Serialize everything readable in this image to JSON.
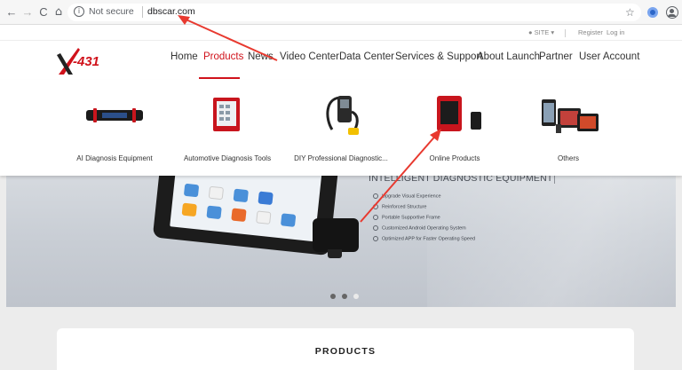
{
  "browser": {
    "icons": {
      "back": "back-arrow-icon",
      "forward": "forward-arrow-icon",
      "reload": "reload-icon",
      "home": "home-icon",
      "info": "info-icon",
      "star": "star-icon",
      "extension": "extension-icon",
      "account": "account-icon"
    },
    "security_label": "Not secure",
    "url": "dbscar.com"
  },
  "topbar": {
    "site_label": "SITE",
    "register_label": "Register",
    "login_label": "Log in"
  },
  "brand": {
    "logo_text": "-431",
    "accent_color": "#d0121b"
  },
  "main_nav": {
    "items": [
      {
        "label": "Home"
      },
      {
        "label": "Products",
        "active": true
      },
      {
        "label": "News"
      },
      {
        "label": "Video Center"
      },
      {
        "label": "Data Center"
      },
      {
        "label": "Services & Support"
      },
      {
        "label": "About Launch"
      },
      {
        "label": "Partner"
      },
      {
        "label": "User Account"
      }
    ]
  },
  "products_dropdown": {
    "categories": [
      {
        "label": "AI Diagnosis Equipment"
      },
      {
        "label": "Automotive Diagnosis Tools"
      },
      {
        "label": "DIY Professional Diagnostic..."
      },
      {
        "label": "Online Products"
      },
      {
        "label": "Others"
      }
    ]
  },
  "hero": {
    "title": "INTELLIGENT DIAGNOSTIC EQUIPMENT",
    "features": [
      {
        "text": "Upgrade Visual Experience"
      },
      {
        "text": "Reinforced Structure"
      },
      {
        "text": "Portable Supportive Frame"
      },
      {
        "text": "Customized Android Operating System"
      },
      {
        "text": "Optimized APP for Faster Operating Speed"
      }
    ],
    "slide_count": 3,
    "active_slide": 1
  },
  "products_section": {
    "title": "PRODUCTS"
  }
}
